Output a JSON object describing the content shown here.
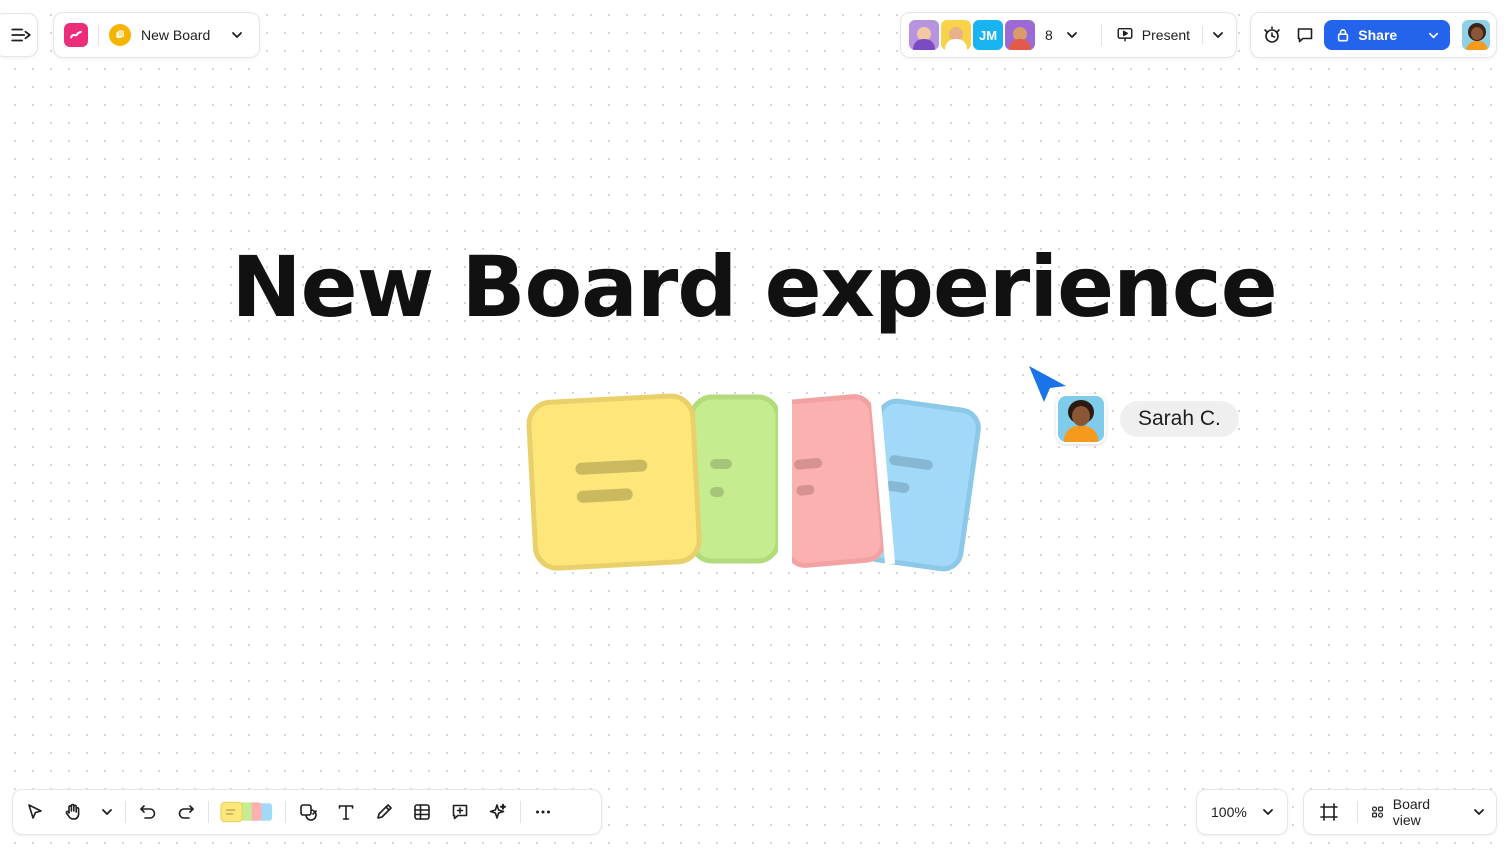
{
  "board": {
    "title": "New Board"
  },
  "collaborators": {
    "avatars": [
      {
        "name": "avatar-1",
        "bg": "#b893e0"
      },
      {
        "name": "avatar-2",
        "bg": "#f7d24a"
      },
      {
        "initials": "JM",
        "bg": "#18b4f2"
      },
      {
        "name": "avatar-4",
        "bg": "#9b6ad6"
      }
    ],
    "count": "8"
  },
  "toolbar_top": {
    "present_label": "Present",
    "share_label": "Share"
  },
  "canvas": {
    "title": "New Board experience",
    "sticky_colors": [
      "#fde77b",
      "#c5ec8e",
      "#fbb1b0",
      "#a3d9f8"
    ],
    "remote_user": {
      "name": "Sarah C.",
      "cursor_color": "#1a73e8"
    }
  },
  "toolbar_bottom": {
    "zoom": "100%",
    "view_label": "Board view"
  },
  "colors": {
    "accent": "#2463eb",
    "brand": "#ec2d7a"
  }
}
